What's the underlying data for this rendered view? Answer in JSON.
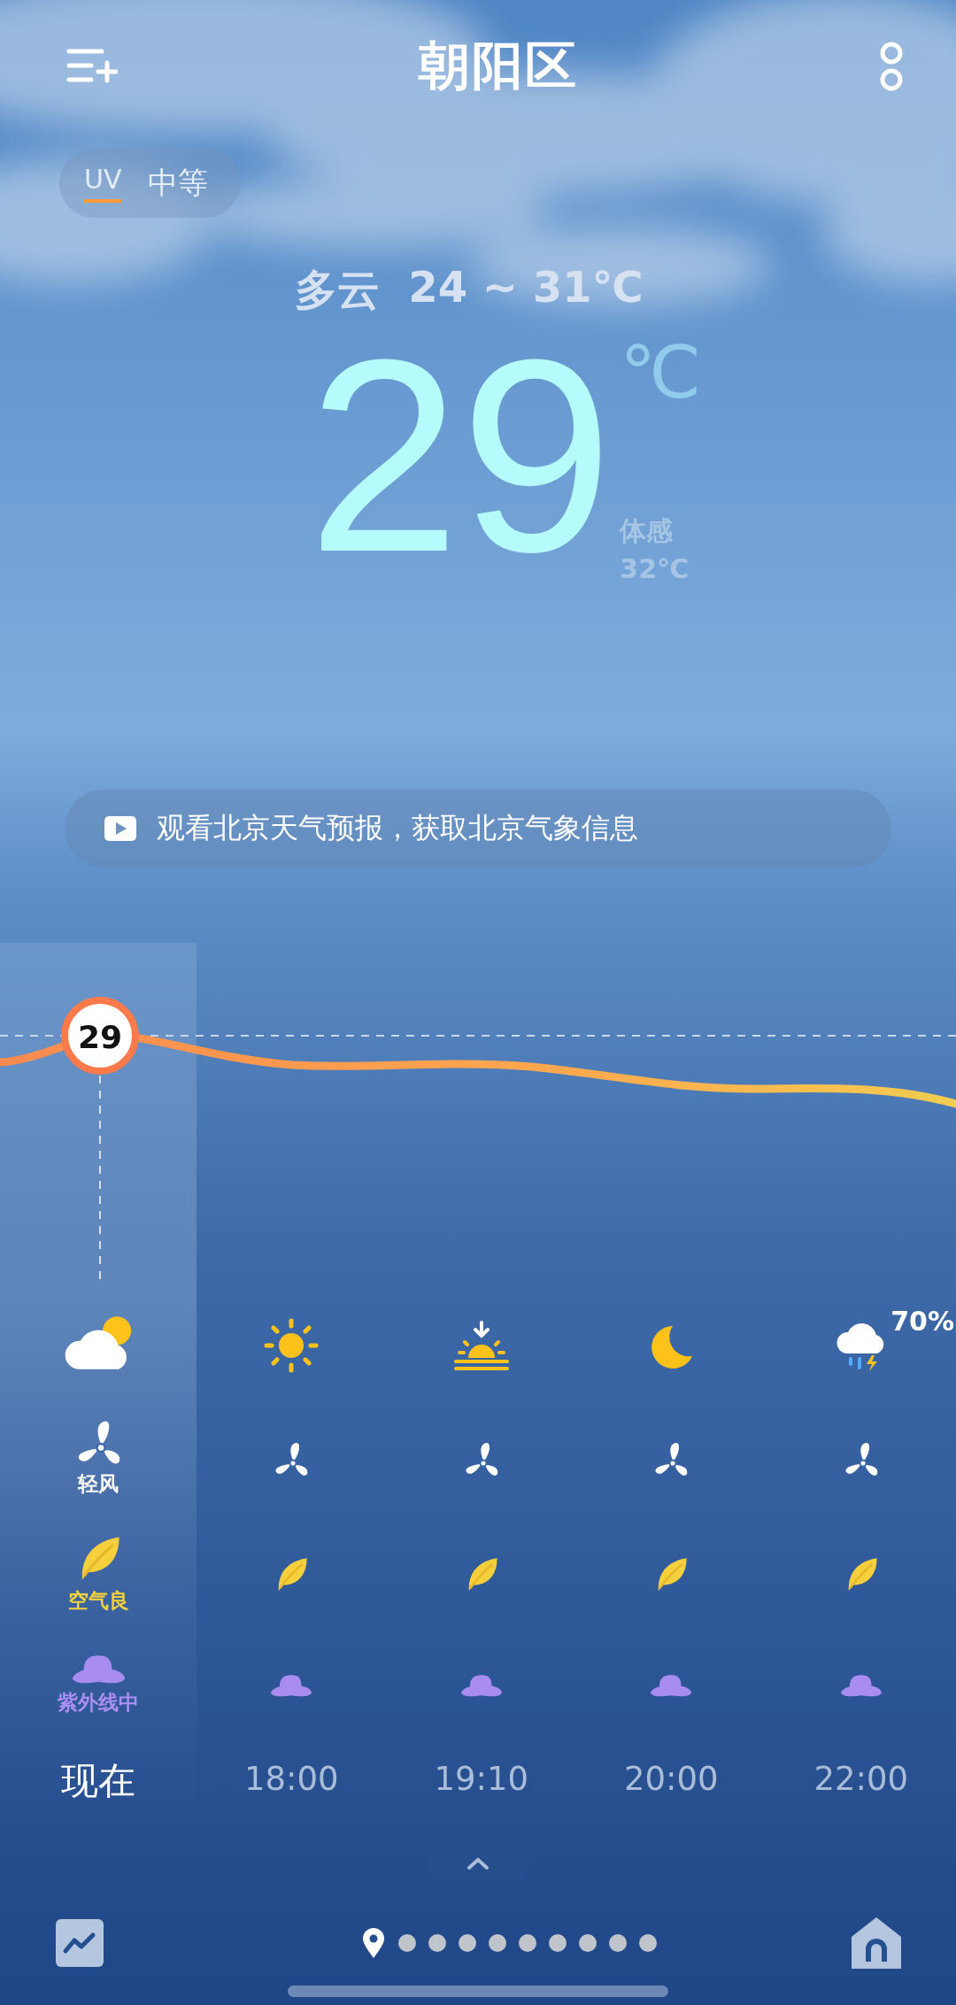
{
  "header": {
    "title": "朝阳区"
  },
  "uv_badge": {
    "label": "UV",
    "value": "中等"
  },
  "current": {
    "condition": "多云",
    "range": "24 ~ 31℃",
    "temperature": "29",
    "unit": "℃",
    "feels_label": "体感",
    "feels_value": "32℃"
  },
  "banner": {
    "text": "观看北京天气预报，获取北京气象信息"
  },
  "chart": {
    "marker_label": "29"
  },
  "hours": [
    {
      "time": "现在",
      "selected": true,
      "kind": "partly_cloudy",
      "wind": "轻风",
      "air": "空气良",
      "uv": "紫外线中"
    },
    {
      "time": "18:00",
      "selected": false,
      "kind": "sunny"
    },
    {
      "time": "19:10",
      "selected": false,
      "kind": "sunset"
    },
    {
      "time": "20:00",
      "selected": false,
      "kind": "night"
    },
    {
      "time": "22:00",
      "selected": false,
      "kind": "thunder_rain",
      "precip": "70%"
    }
  ],
  "pages": [
    {
      "kind": "location",
      "selected": true
    },
    {
      "kind": "dot",
      "selected": false
    },
    {
      "kind": "dot",
      "selected": false
    },
    {
      "kind": "dot",
      "selected": false
    },
    {
      "kind": "dot",
      "selected": false
    },
    {
      "kind": "dot",
      "selected": false
    },
    {
      "kind": "dot",
      "selected": false
    },
    {
      "kind": "dot",
      "selected": false
    },
    {
      "kind": "dot",
      "selected": false
    },
    {
      "kind": "dot",
      "selected": false
    }
  ]
}
